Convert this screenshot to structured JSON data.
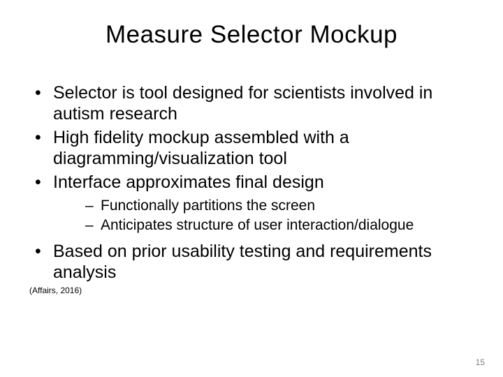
{
  "title": "Measure Selector Mockup",
  "bullets": {
    "b1": "Selector is tool designed for scientists involved in autism research",
    "b2": "High fidelity mockup assembled with a diagramming/visualization tool",
    "b3": "Interface approximates final design",
    "b3_sub1": "Functionally partitions the screen",
    "b3_sub2": "Anticipates structure of user interaction/dialogue",
    "b4": "Based on prior usability testing and requirements analysis"
  },
  "citation": "(Affairs, 2016)",
  "page_number": "15"
}
